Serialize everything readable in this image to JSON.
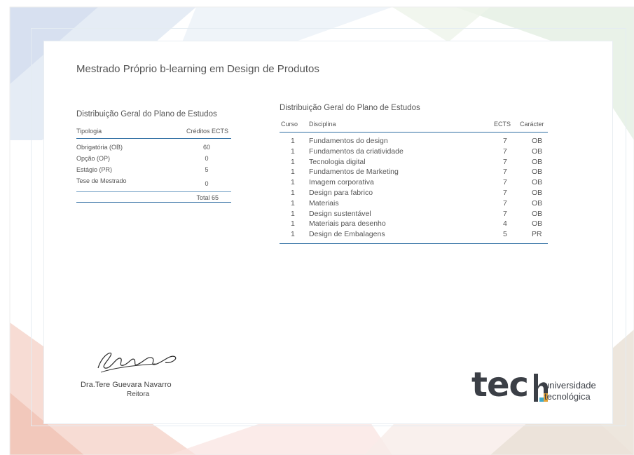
{
  "document": {
    "title": "Mestrado Próprio b-learning em Design de Produtos"
  },
  "summary_table": {
    "title": "Distribuição Geral do Plano de Estudos",
    "headers": [
      "Tipologia",
      "Créditos ECTS"
    ],
    "rows": [
      {
        "type": "Obrigatória (OB)",
        "credits": "60"
      },
      {
        "type": "Opção (OP)",
        "credits": "0"
      },
      {
        "type": "Estágio (PR)",
        "credits": "5"
      },
      {
        "type": "Tese de Mestrado",
        "credits": "0"
      }
    ],
    "total": "Total 65"
  },
  "detail_table": {
    "title": "Distribuição Geral do Plano de Estudos",
    "headers": [
      "Curso",
      "Disciplina",
      "ECTS",
      "Carácter"
    ],
    "rows": [
      {
        "curso": "1",
        "disciplina": "Fundamentos do design",
        "ects": "7",
        "caracter": "OB"
      },
      {
        "curso": "1",
        "disciplina": "Fundamentos da criatividade",
        "ects": "7",
        "caracter": "OB"
      },
      {
        "curso": "1",
        "disciplina": "Tecnologia digital",
        "ects": "7",
        "caracter": "OB"
      },
      {
        "curso": "1",
        "disciplina": "Fundamentos de Marketing",
        "ects": "7",
        "caracter": "OB"
      },
      {
        "curso": "1",
        "disciplina": "Imagem corporativa",
        "ects": "7",
        "caracter": "OB"
      },
      {
        "curso": "1",
        "disciplina": "Design para fabrico",
        "ects": "7",
        "caracter": "OB"
      },
      {
        "curso": "1",
        "disciplina": "Materiais",
        "ects": "7",
        "caracter": "OB"
      },
      {
        "curso": "1",
        "disciplina": "Design sustentável",
        "ects": "7",
        "caracter": "OB"
      },
      {
        "curso": "1",
        "disciplina": "Materiais para desenho",
        "ects": "4",
        "caracter": "OB"
      },
      {
        "curso": "1",
        "disciplina": "Design de Embalagens",
        "ects": "5",
        "caracter": "PR"
      }
    ]
  },
  "signatory": {
    "name": "Dra.Tere Guevara Navarro",
    "role": "Reitora"
  },
  "logo": {
    "word": "tec",
    "line1": "universidade",
    "line2": "tecnológica",
    "accent_colors": [
      "#e3a33a",
      "#3fa9c9"
    ]
  },
  "colors": {
    "rule": "#2f6ea3",
    "text": "#555555"
  }
}
